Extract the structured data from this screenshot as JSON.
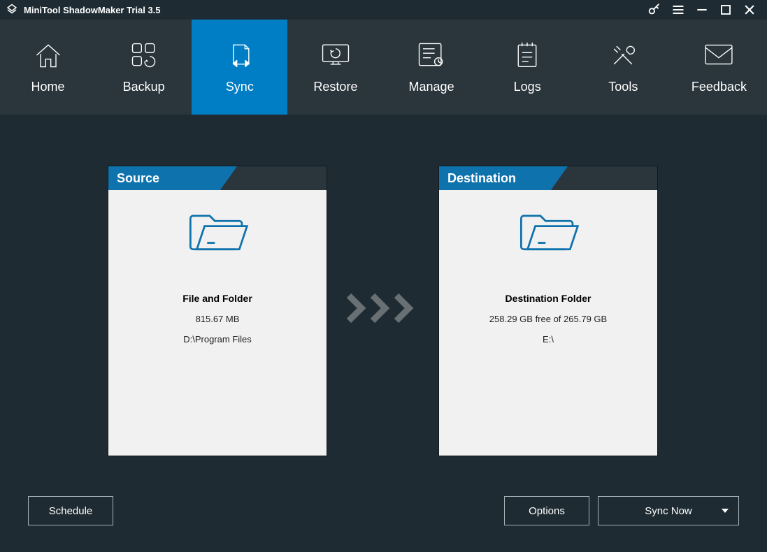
{
  "app": {
    "title": "MiniTool ShadowMaker Trial 3.5"
  },
  "nav": {
    "items": [
      {
        "id": "home",
        "label": "Home"
      },
      {
        "id": "backup",
        "label": "Backup"
      },
      {
        "id": "sync",
        "label": "Sync"
      },
      {
        "id": "restore",
        "label": "Restore"
      },
      {
        "id": "manage",
        "label": "Manage"
      },
      {
        "id": "logs",
        "label": "Logs"
      },
      {
        "id": "tools",
        "label": "Tools"
      },
      {
        "id": "feedback",
        "label": "Feedback"
      }
    ],
    "active_id": "sync"
  },
  "source": {
    "header": "Source",
    "title": "File and Folder",
    "size": "815.67 MB",
    "path": "D:\\Program Files"
  },
  "destination": {
    "header": "Destination",
    "title": "Destination Folder",
    "free": "258.29 GB free of 265.79 GB",
    "path": "E:\\"
  },
  "footer": {
    "schedule": "Schedule",
    "options": "Options",
    "syncnow": "Sync Now"
  },
  "colors": {
    "accent": "#007ec5",
    "cardHeader": "#0e72ac"
  }
}
